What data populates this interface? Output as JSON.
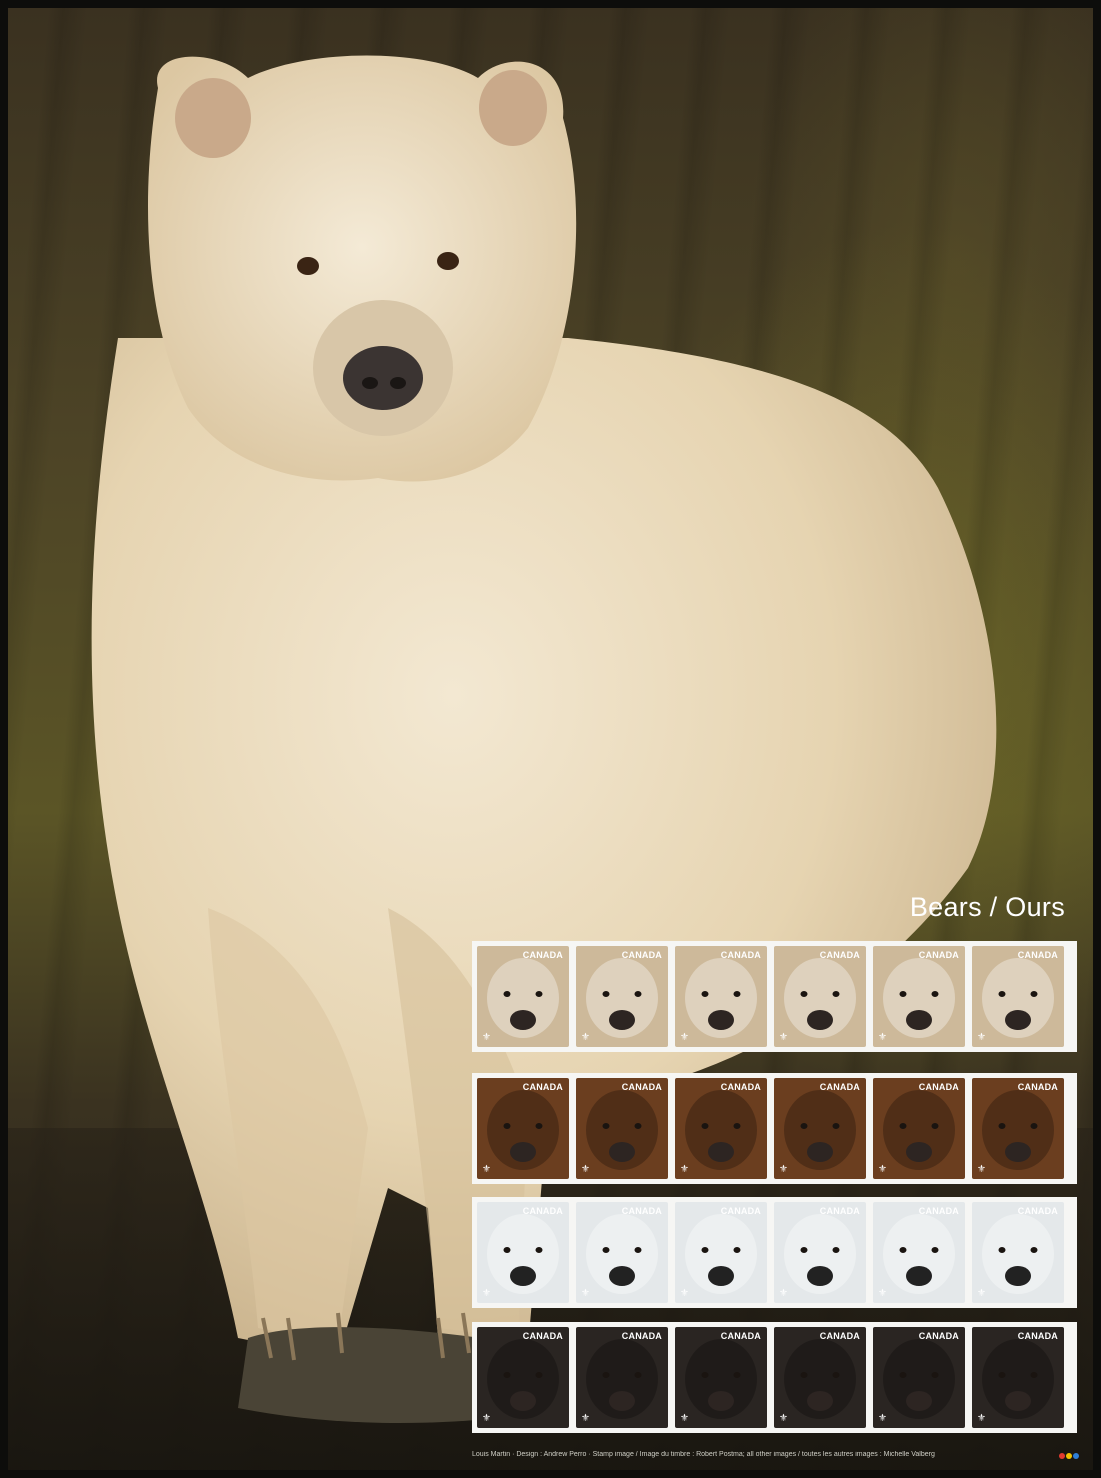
{
  "sheet": {
    "title": "Bears / Ours",
    "credits": "Louis Martin · Design : Andrew Perro · Stamp image / Image du timbre : Robert Postma; all other images / toutes les autres images : Michelle Valberg"
  },
  "stamp_label": "CANADA",
  "rows": [
    {
      "name": "spirit-bear",
      "tone": "#cdb99a",
      "stamps": 6
    },
    {
      "name": "grizzly-bear",
      "tone": "#6b3e1f",
      "stamps": 6
    },
    {
      "name": "polar-bear",
      "tone": "#e4e8ea",
      "stamps": 6
    },
    {
      "name": "black-bear",
      "tone": "#2a2522",
      "stamps": 6
    }
  ],
  "colors": {
    "title_text": "#ffffff",
    "perforation_border": "#f6f6f4",
    "fur": "#eadcbf"
  }
}
